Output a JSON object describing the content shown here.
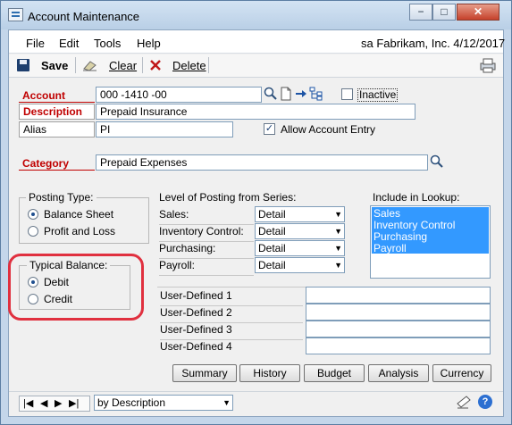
{
  "window": {
    "title": "Account Maintenance",
    "min_label": "−",
    "max_label": "□",
    "close_label": "✕"
  },
  "menu": {
    "items": [
      "File",
      "Edit",
      "Tools",
      "Help"
    ],
    "status": "sa  Fabrikam, Inc.  4/12/2017"
  },
  "toolbar": {
    "save": "Save",
    "clear": "Clear",
    "delete": "Delete"
  },
  "form": {
    "account_label": "Account",
    "account_value": "000 -1410 -00",
    "inactive_label": "Inactive",
    "description_label": "Description",
    "description_value": "Prepaid Insurance",
    "alias_label": "Alias",
    "alias_value": "PI",
    "allow_entry_label": "Allow Account Entry",
    "category_label": "Category",
    "category_value": "Prepaid Expenses"
  },
  "posting_type": {
    "title": "Posting Type:",
    "options": [
      "Balance Sheet",
      "Profit and Loss"
    ],
    "selected": "Balance Sheet"
  },
  "typical_balance": {
    "title": "Typical Balance:",
    "options": [
      "Debit",
      "Credit"
    ],
    "selected": "Debit"
  },
  "level_posting": {
    "title": "Level of Posting from Series:",
    "rows": [
      {
        "label": "Sales:",
        "value": "Detail"
      },
      {
        "label": "Inventory Control:",
        "value": "Detail"
      },
      {
        "label": "Purchasing:",
        "value": "Detail"
      },
      {
        "label": "Payroll:",
        "value": "Detail"
      }
    ]
  },
  "lookup": {
    "title": "Include in Lookup:",
    "items": [
      "Sales",
      "Inventory Control",
      "Purchasing",
      "Payroll"
    ]
  },
  "user_defined": {
    "labels": [
      "User-Defined 1",
      "User-Defined 2",
      "User-Defined 3",
      "User-Defined 4"
    ]
  },
  "buttons": [
    "Summary",
    "History",
    "Budget",
    "Analysis",
    "Currency"
  ],
  "statusbar": {
    "sort": "by Description"
  },
  "colors": {
    "required_label": "#c00000",
    "highlight": "#e0303f",
    "selection": "#3399ff"
  }
}
